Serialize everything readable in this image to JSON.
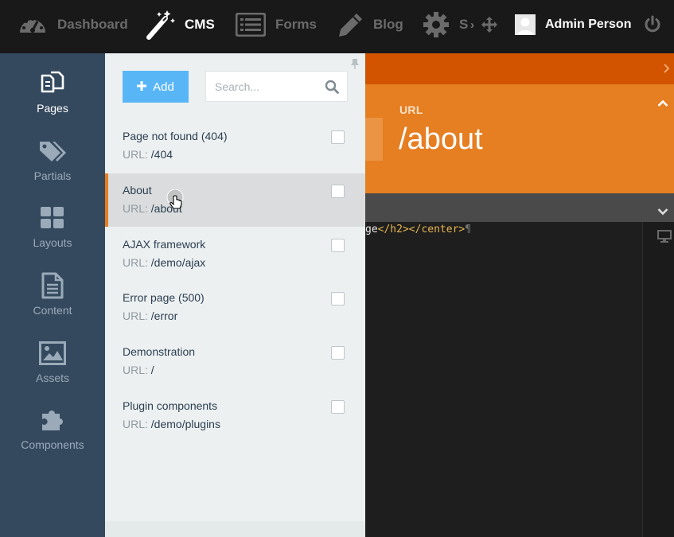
{
  "topnav": {
    "items": [
      {
        "label": "Dashboard",
        "icon": "dashboard-icon",
        "active": false
      },
      {
        "label": "CMS",
        "icon": "magic-wand-icon",
        "active": true
      },
      {
        "label": "Forms",
        "icon": "list-icon",
        "active": false
      },
      {
        "label": "Blog",
        "icon": "pencil-icon",
        "active": false
      },
      {
        "label": "S",
        "icon": "gear-icon",
        "active": false
      }
    ],
    "overflow_separator": "›",
    "user_name": "Admin Person"
  },
  "sidebar": {
    "items": [
      {
        "label": "Pages",
        "icon": "pages-icon",
        "active": true
      },
      {
        "label": "Partials",
        "icon": "tags-icon",
        "active": false
      },
      {
        "label": "Layouts",
        "icon": "layouts-grid-icon",
        "active": false
      },
      {
        "label": "Content",
        "icon": "document-icon",
        "active": false
      },
      {
        "label": "Assets",
        "icon": "image-icon",
        "active": false
      },
      {
        "label": "Components",
        "icon": "puzzle-icon",
        "active": false
      }
    ]
  },
  "panel": {
    "add_label": "Add",
    "search_placeholder": "Search...",
    "url_prefix": "URL:",
    "pages": [
      {
        "title": "Page not found (404)",
        "url": "/404",
        "selected": false
      },
      {
        "title": "About",
        "url": "/about",
        "selected": true
      },
      {
        "title": "AJAX framework",
        "url": "/demo/ajax",
        "selected": false
      },
      {
        "title": "Error page (500)",
        "url": "/error",
        "selected": false
      },
      {
        "title": "Demonstration",
        "url": "/",
        "selected": false
      },
      {
        "title": "Plugin components",
        "url": "/demo/plugins",
        "selected": false
      }
    ]
  },
  "editor": {
    "url_label": "URL",
    "url_value": "/about",
    "code_fragments": [
      "ge",
      "</h2></center>",
      "¶"
    ]
  },
  "colors": {
    "accent_orange": "#e67e22",
    "dark_orange": "#d35400",
    "sidebar_bg": "#34495e",
    "add_button": "#58b6f7"
  }
}
